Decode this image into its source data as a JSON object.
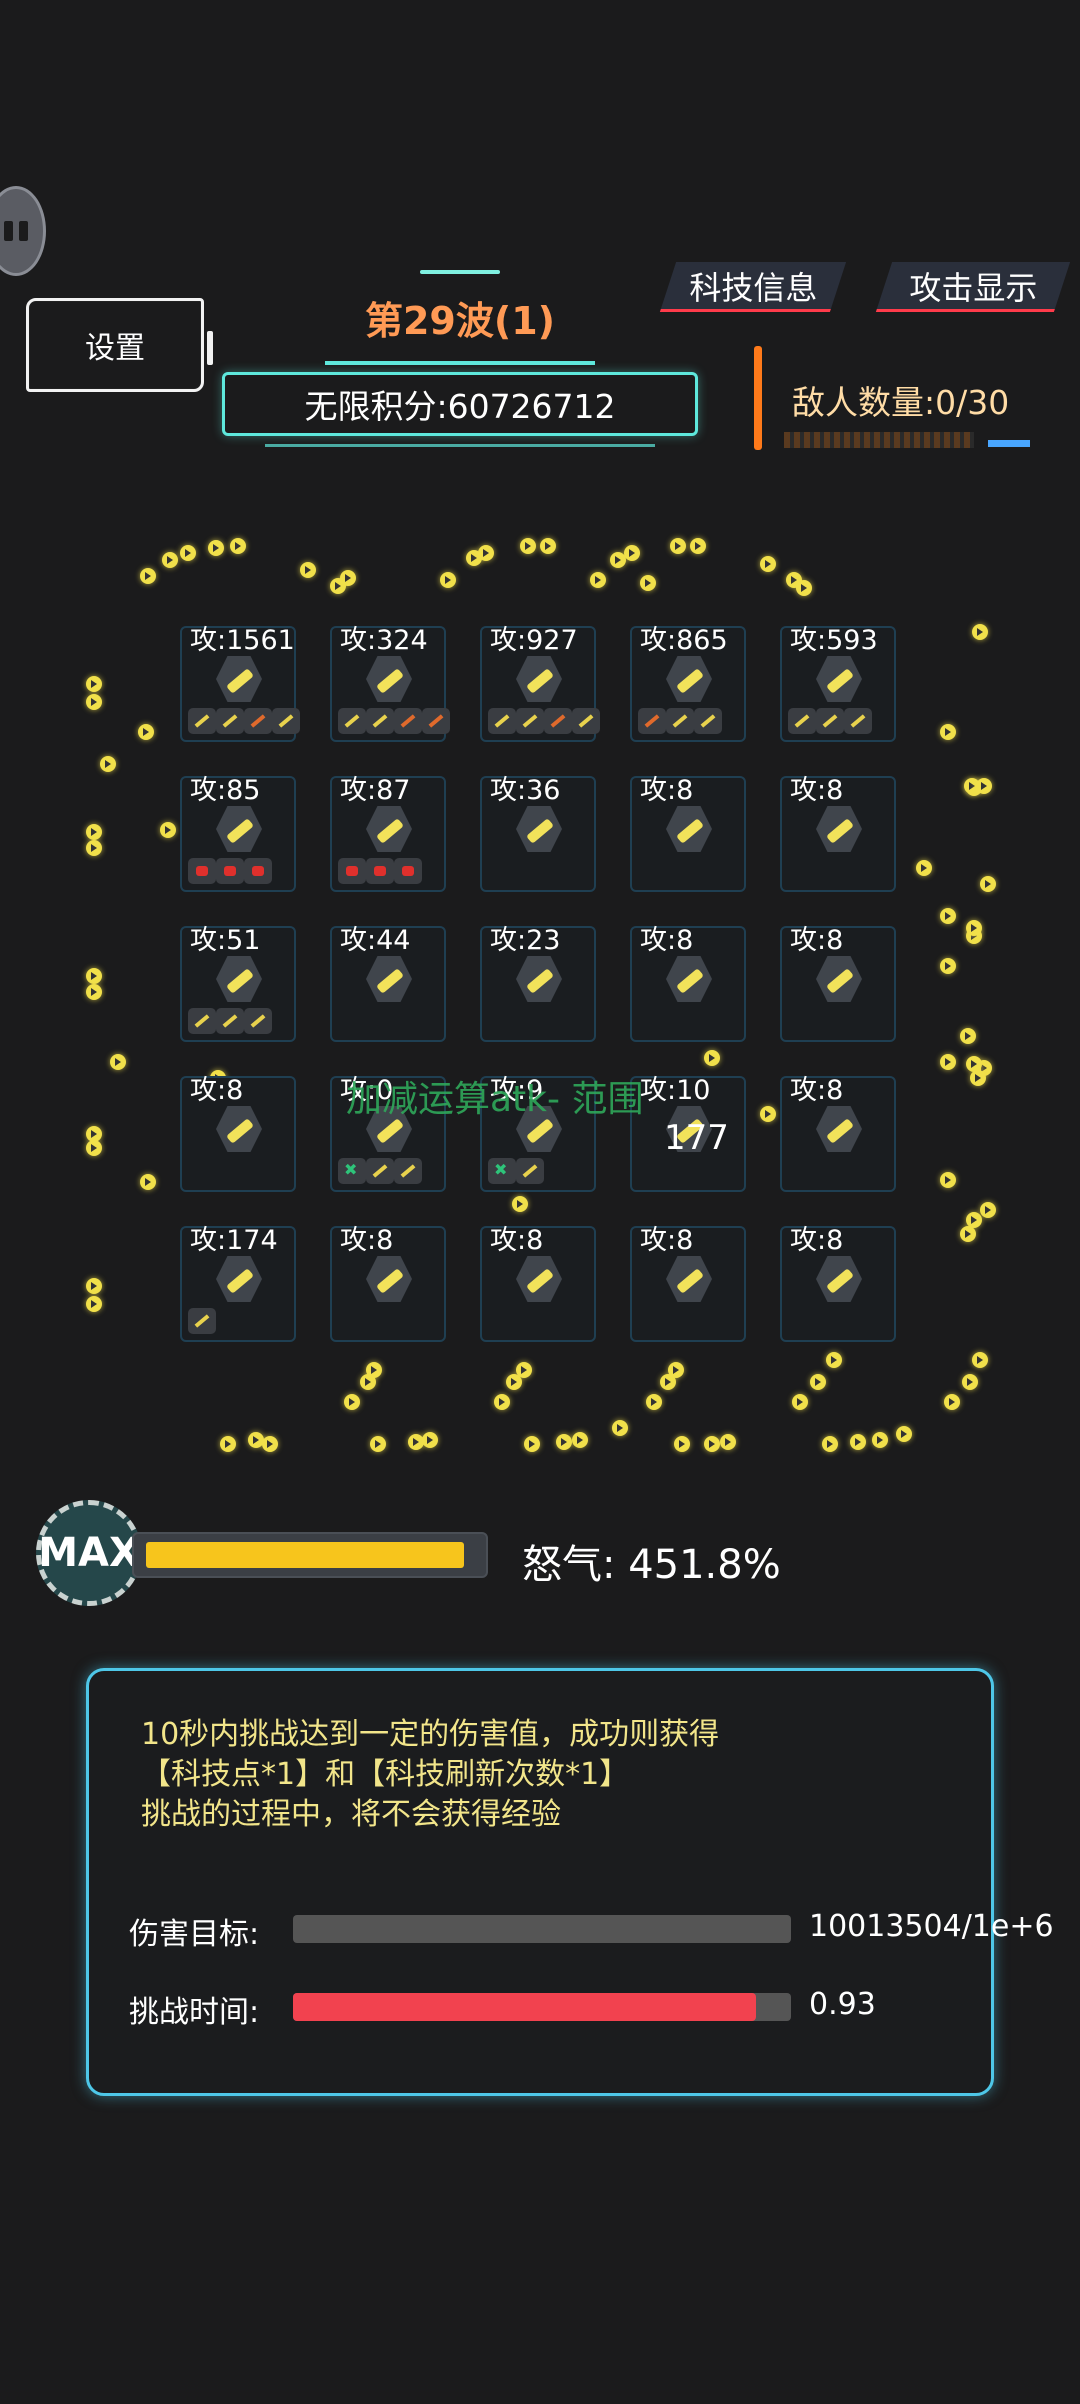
{
  "header": {
    "settings_label": "设置",
    "wave_title": "第29波(1)",
    "score_text": "无限积分:60726712",
    "tech_info_label": "科技信息",
    "attack_display_label": "攻击显示",
    "enemy_count_text": "敌人数量:0/30"
  },
  "grid": {
    "cells": [
      {
        "atk": "攻:1561",
        "chips": [
          "gold",
          "gold",
          "orange",
          "gold"
        ]
      },
      {
        "atk": "攻:324",
        "chips": [
          "gold",
          "gold",
          "orange",
          "orange"
        ]
      },
      {
        "atk": "攻:927",
        "chips": [
          "gold",
          "gold",
          "orange",
          "gold"
        ]
      },
      {
        "atk": "攻:865",
        "chips": [
          "orange",
          "gold",
          "gold"
        ]
      },
      {
        "atk": "攻:593",
        "chips": [
          "gold",
          "gold",
          "gold"
        ]
      },
      {
        "atk": "攻:85",
        "chips": [
          "red",
          "red",
          "red"
        ]
      },
      {
        "atk": "攻:87",
        "chips": [
          "red",
          "red",
          "red"
        ]
      },
      {
        "atk": "攻:36",
        "chips": []
      },
      {
        "atk": "攻:8",
        "chips": []
      },
      {
        "atk": "攻:8",
        "chips": []
      },
      {
        "atk": "攻:51",
        "chips": [
          "gold",
          "gold",
          "gold"
        ]
      },
      {
        "atk": "攻:44",
        "chips": []
      },
      {
        "atk": "攻:23",
        "chips": []
      },
      {
        "atk": "攻:8",
        "chips": []
      },
      {
        "atk": "攻:8",
        "chips": []
      },
      {
        "atk": "攻:8",
        "chips": []
      },
      {
        "atk": "攻:0",
        "chips": [
          "green",
          "gold",
          "gold"
        ]
      },
      {
        "atk": "攻:9",
        "chips": [
          "green",
          "gold"
        ]
      },
      {
        "atk": "攻:10",
        "chips": []
      },
      {
        "atk": "攻:8",
        "chips": []
      },
      {
        "atk": "攻:174",
        "chips": [
          "gold"
        ]
      },
      {
        "atk": "攻:8",
        "chips": []
      },
      {
        "atk": "攻:8",
        "chips": []
      },
      {
        "atk": "攻:8",
        "chips": []
      },
      {
        "atk": "攻:8",
        "chips": []
      }
    ],
    "floating_text": "加减运算atk- 范围",
    "floating_number": "177"
  },
  "rage": {
    "badge_label": "MAX",
    "text": "怒气: 451.8%",
    "fill_fraction": 1.0
  },
  "challenge": {
    "description": "10秒内挑战达到一定的伤害值，成功则获得\n【科技点*1】和【科技刷新次数*1】\n挑战的过程中，将不会获得经验",
    "damage_label": "伤害目标:",
    "damage_value": "10013504/1e+6",
    "damage_fill_fraction": 0.0,
    "time_label": "挑战时间:",
    "time_value": "0.93",
    "time_fill_fraction": 0.93
  },
  "colors": {
    "rage_fill": "#f7c51c",
    "time_fill": "#f2424f",
    "panel_border": "#4ec7e8",
    "wave_title": "#ff9a55"
  }
}
